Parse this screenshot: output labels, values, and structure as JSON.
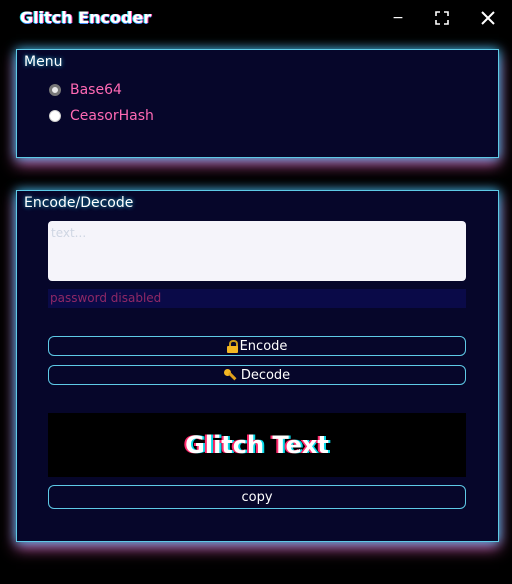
{
  "window": {
    "title": "Glitch Encoder",
    "minimize_label": "−",
    "maximize_label": "⛶",
    "close_label": "✕"
  },
  "menu": {
    "title": "Menu",
    "options": [
      {
        "label": "Base64",
        "selected": true
      },
      {
        "label": "CeasorHash",
        "selected": false
      }
    ]
  },
  "encode": {
    "title": "Encode/Decode",
    "text_placeholder": "text...",
    "password_placeholder": "password disabled",
    "encode_label": "Encode",
    "decode_label": "Decode",
    "output_text": "Glitch Text",
    "copy_label": "copy"
  },
  "icons": {
    "encode": "lock-icon",
    "decode": "key-icon"
  },
  "colors": {
    "background": "#000000",
    "panel": "#06062a",
    "accent_cyan": "#5ec9e6",
    "accent_pink": "#ff69b4",
    "glitch_red": "#ff2a6d",
    "glitch_cyan": "#05d9e8"
  }
}
